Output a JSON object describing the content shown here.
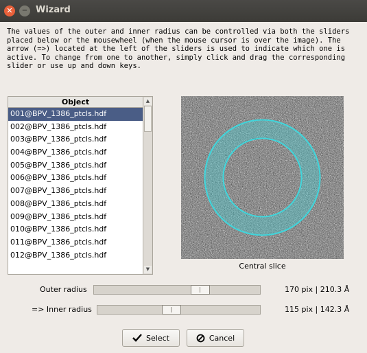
{
  "window": {
    "title": "Wizard",
    "close_symbol": "✕",
    "minimize_symbol": "−"
  },
  "description": "The values of the outer and inner radius can be controlled via both the sliders\nplaced below or the mousewheel (when the mouse cursor is over the image). The\narrow (=>) located at the left of the sliders is used to indicate which one is\nactive. To change from one to another, simply click and drag the corresponding\nslider or use up and down keys.",
  "list": {
    "header": "Object",
    "items": [
      "001@BPV_1386_ptcls.hdf",
      "002@BPV_1386_ptcls.hdf",
      "003@BPV_1386_ptcls.hdf",
      "004@BPV_1386_ptcls.hdf",
      "005@BPV_1386_ptcls.hdf",
      "006@BPV_1386_ptcls.hdf",
      "007@BPV_1386_ptcls.hdf",
      "008@BPV_1386_ptcls.hdf",
      "009@BPV_1386_ptcls.hdf",
      "010@BPV_1386_ptcls.hdf",
      "011@BPV_1386_ptcls.hdf",
      "012@BPV_1386_ptcls.hdf"
    ],
    "selected_index": 0
  },
  "image": {
    "caption": "Central slice",
    "ring_color": "#3fd6dc"
  },
  "sliders": {
    "outer": {
      "label": "Outer radius",
      "position": 0.66,
      "value": "170 pix |  210.3 Å"
    },
    "inner": {
      "label": "=> Inner radius",
      "position": 0.45,
      "value": "115 pix |  142.3 Å"
    }
  },
  "buttons": {
    "select": "Select",
    "cancel": "Cancel"
  }
}
